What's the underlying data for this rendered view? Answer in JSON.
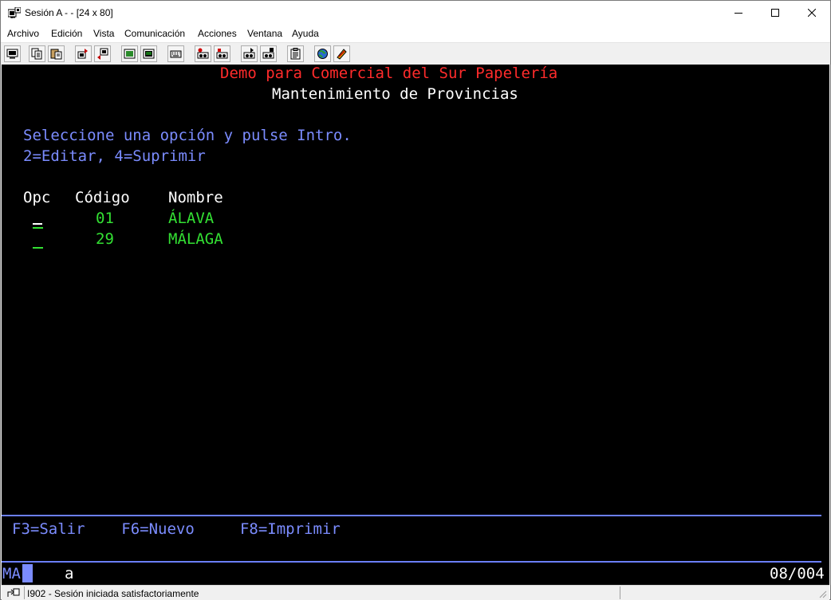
{
  "window": {
    "title": "Sesión A -  - [24 x 80]"
  },
  "menu": {
    "items": [
      "Archivo",
      "Edición",
      "Vista",
      "Comunicación",
      "Acciones",
      "Ventana",
      "Ayuda"
    ]
  },
  "toolbar": {
    "icons": [
      "print-screen-icon",
      "copy-icon",
      "paste-icon",
      "send-file-icon",
      "receive-file-icon",
      "display-icon",
      "keyboard-map-icon",
      "keypad-icon",
      "macro-record-icon",
      "macro-stop-icon",
      "macro-play-icon",
      "macro-run-icon",
      "clipboard-icon",
      "globe-icon",
      "help-icon"
    ]
  },
  "screen": {
    "header_company": "Demo para Comercial del Sur Papelería",
    "header_title": "Mantenimiento de Provincias",
    "instruction": "Seleccione una opción y pulse Intro.",
    "options": "2=Editar, 4=Suprimir",
    "columns": {
      "opc": "Opc",
      "codigo": "Código",
      "nombre": "Nombre"
    },
    "rows": [
      {
        "codigo": "01",
        "nombre": "ÁLAVA"
      },
      {
        "codigo": "29",
        "nombre": "MÁLAGA"
      }
    ],
    "function_keys": "F3=Salir    F6=Nuevo     F8=Imprimir",
    "oia": {
      "ma": "MA",
      "a": "a",
      "position": "08/004"
    }
  },
  "colors": {
    "screen_bg": "#000000",
    "red": "#ff2b2b",
    "blue": "#7b8cff",
    "green": "#33e033",
    "white": "#ffffff"
  },
  "statusbar": {
    "message": "I902 - Sesión iniciada satisfactoriamente"
  }
}
